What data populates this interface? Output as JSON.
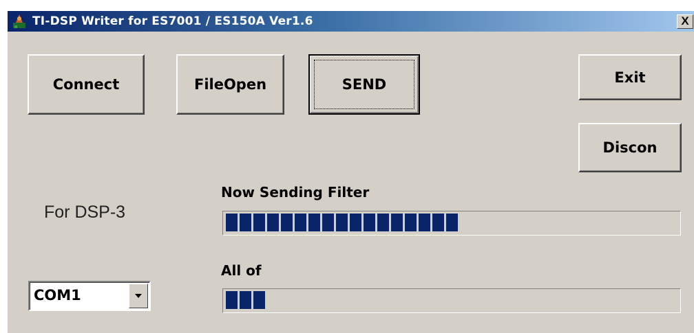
{
  "window": {
    "title": "TI-DSP Writer for ES7001 / ES150A Ver1.6",
    "close_label": "X"
  },
  "buttons": {
    "connect": "Connect",
    "fileopen": "FileOpen",
    "send": "SEND",
    "exit": "Exit",
    "discon": "Discon"
  },
  "labels": {
    "for_dsp": "For DSP-3",
    "now_sending": "Now Sending Filter",
    "all_of": "All of"
  },
  "progress": {
    "filter_blocks": 17,
    "all_blocks": 3,
    "color": "#0a246a"
  },
  "com_port": {
    "selected": "COM1"
  },
  "icons": {
    "app": "app-icon",
    "dropdown": "chevron-down-icon"
  }
}
